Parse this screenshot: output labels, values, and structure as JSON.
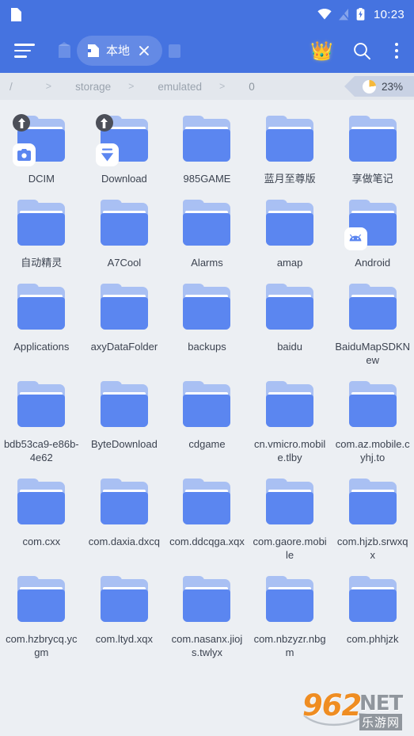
{
  "status_bar": {
    "notification_icon": "document-icon",
    "wifi_icon": "wifi-icon",
    "signal_icon": "signal-off-icon",
    "battery_icon": "battery-charging-icon",
    "clock": "10:23"
  },
  "toolbar": {
    "menu_icon": "hamburger-menu-icon",
    "home_tab_icon": "home-tab-icon",
    "active_tab_label": "本地",
    "active_tab_icon": "storage-tab-icon",
    "close_icon": "close-icon",
    "extra_tab_icon": "inactive-tab-icon",
    "vip_icon": "crown-icon",
    "search_icon": "search-icon",
    "overflow_icon": "kebab-menu-icon",
    "background_color": "#4573e0"
  },
  "breadcrumb": {
    "separator": ">",
    "segments": [
      "/",
      "storage",
      "emulated",
      "0"
    ],
    "storage": {
      "percent_label": "23%",
      "percent_value": 23,
      "pie_color": "#f6b93b"
    }
  },
  "grid": {
    "columns": 5,
    "folder_color": "#5b86f0",
    "folder_tab_color": "#a9c0f3",
    "items": [
      {
        "name": "DCIM",
        "badge_type": "camera-icon",
        "badge_corner": "pinned-icon"
      },
      {
        "name": "Download",
        "badge_type": "download-icon",
        "badge_corner": "pinned-icon"
      },
      {
        "name": "985GAME",
        "badge_type": null,
        "badge_corner": null
      },
      {
        "name": "蓝月至尊版",
        "badge_type": null,
        "badge_corner": null
      },
      {
        "name": "享做笔记",
        "badge_type": null,
        "badge_corner": null
      },
      {
        "name": "自动精灵",
        "badge_type": null,
        "badge_corner": null
      },
      {
        "name": "A7Cool",
        "badge_type": null,
        "badge_corner": null
      },
      {
        "name": "Alarms",
        "badge_type": null,
        "badge_corner": null
      },
      {
        "name": "amap",
        "badge_type": null,
        "badge_corner": null
      },
      {
        "name": "Android",
        "badge_type": "android-icon",
        "badge_corner": null
      },
      {
        "name": "Applications",
        "badge_type": null,
        "badge_corner": null
      },
      {
        "name": "axyDataFolder",
        "badge_type": null,
        "badge_corner": null
      },
      {
        "name": "backups",
        "badge_type": null,
        "badge_corner": null
      },
      {
        "name": "baidu",
        "badge_type": null,
        "badge_corner": null
      },
      {
        "name": "BaiduMapSDKNew",
        "badge_type": null,
        "badge_corner": null
      },
      {
        "name": "bdb53ca9-e86b-4e62",
        "badge_type": null,
        "badge_corner": null
      },
      {
        "name": "ByteDownload",
        "badge_type": null,
        "badge_corner": null
      },
      {
        "name": "cdgame",
        "badge_type": null,
        "badge_corner": null
      },
      {
        "name": "cn.vmicro.mobile.tlby",
        "badge_type": null,
        "badge_corner": null
      },
      {
        "name": "com.az.mobile.cyhj.to",
        "badge_type": null,
        "badge_corner": null
      },
      {
        "name": "com.cxx",
        "badge_type": null,
        "badge_corner": null
      },
      {
        "name": "com.daxia.dxcq",
        "badge_type": null,
        "badge_corner": null
      },
      {
        "name": "com.ddcqga.xqx",
        "badge_type": null,
        "badge_corner": null
      },
      {
        "name": "com.gaore.mobile",
        "badge_type": null,
        "badge_corner": null
      },
      {
        "name": "com.hjzb.srwxqx",
        "badge_type": null,
        "badge_corner": null
      },
      {
        "name": "com.hzbrycq.ycgm",
        "badge_type": null,
        "badge_corner": null
      },
      {
        "name": "com.ltyd.xqx",
        "badge_type": null,
        "badge_corner": null
      },
      {
        "name": "com.nasanx.jiojs.twlyx",
        "badge_type": null,
        "badge_corner": null
      },
      {
        "name": "com.nbzyzr.nbgm",
        "badge_type": null,
        "badge_corner": null
      },
      {
        "name": "com.phhjzk",
        "badge_type": null,
        "badge_corner": null
      }
    ]
  },
  "watermark": {
    "number": "962",
    "suffix": "NET",
    "subtitle": "乐游网"
  }
}
